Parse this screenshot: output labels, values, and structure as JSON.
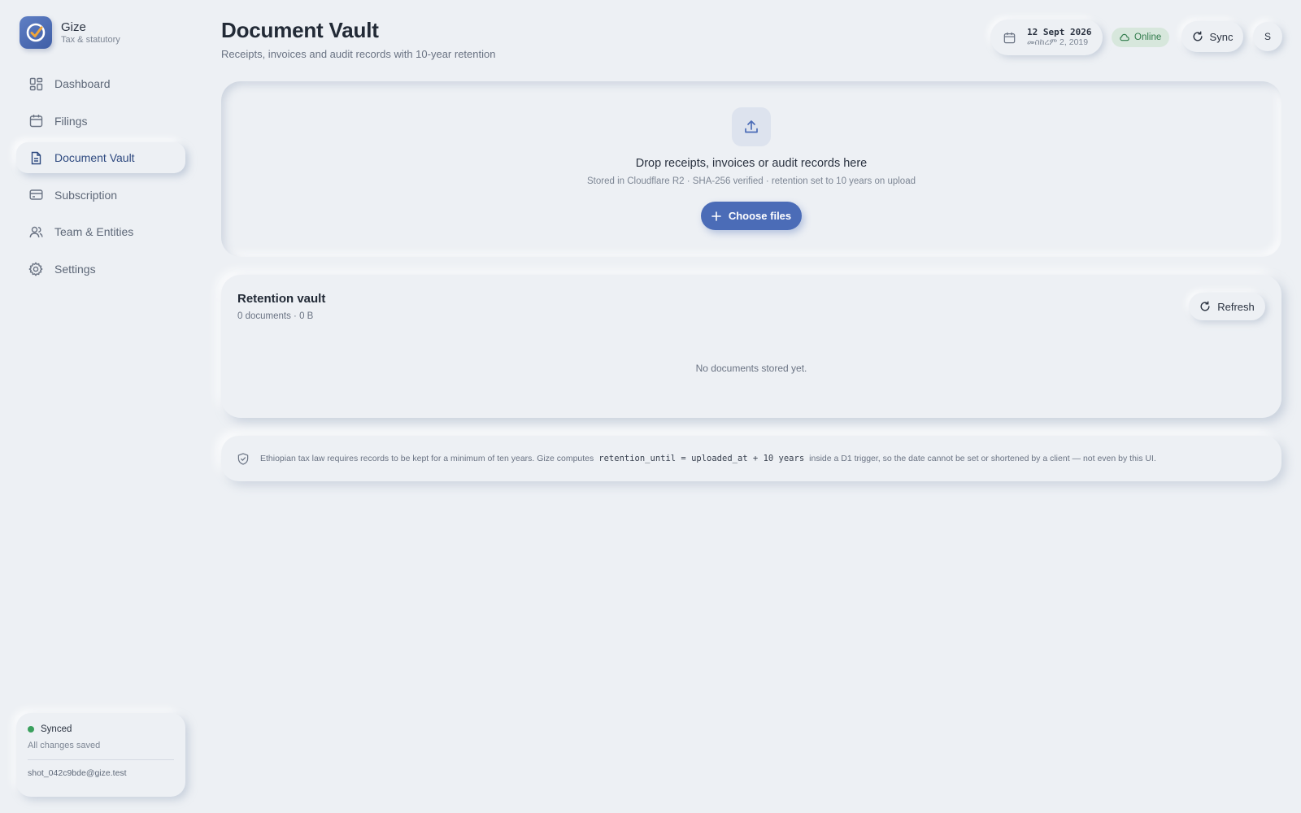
{
  "brand": {
    "name": "Gize",
    "subtitle": "Tax & statutory"
  },
  "sidebar": {
    "items": [
      {
        "label": "Dashboard",
        "icon": "dashboard-icon",
        "active": false
      },
      {
        "label": "Filings",
        "icon": "calendar-icon",
        "active": false
      },
      {
        "label": "Document Vault",
        "icon": "document-icon",
        "active": true
      },
      {
        "label": "Subscription",
        "icon": "credit-card-icon",
        "active": false
      },
      {
        "label": "Team & Entities",
        "icon": "users-icon",
        "active": false
      },
      {
        "label": "Settings",
        "icon": "gear-icon",
        "active": false
      }
    ],
    "sync_card": {
      "status": "Synced",
      "note": "All changes saved",
      "email": "shot_042c9bde@gize.test",
      "status_color": "#3aa05d"
    }
  },
  "header": {
    "title": "Document Vault",
    "subtitle": "Receipts, invoices and audit records with 10-year retention",
    "date_primary": "12 Sept 2026",
    "date_ethiopian": "መስከረም 2, 2019",
    "online_label": "Online",
    "sync_label": "Sync",
    "avatar_initial": "S"
  },
  "upload": {
    "title": "Drop receipts, invoices or audit records here",
    "subtitle": "Stored in Cloudflare R2 · SHA-256 verified · retention set to 10 years on upload",
    "button_label": "Choose files"
  },
  "vault": {
    "title": "Retention vault",
    "meta": "0 documents · 0 B",
    "refresh_label": "Refresh",
    "empty_text": "No documents stored yet."
  },
  "notice": {
    "text_before": "Ethiopian tax law requires records to be kept for a minimum of ten years. Gize computes",
    "code": "retention_until = uploaded_at + 10 years",
    "text_after": "inside a D1 trigger, so the date cannot be set or shortened by a client — not even by this UI."
  },
  "colors": {
    "background": "#edf0f4",
    "accent": "#4b6cb7",
    "online_bg": "#d7e7dc",
    "online_text": "#2f7a4a"
  }
}
